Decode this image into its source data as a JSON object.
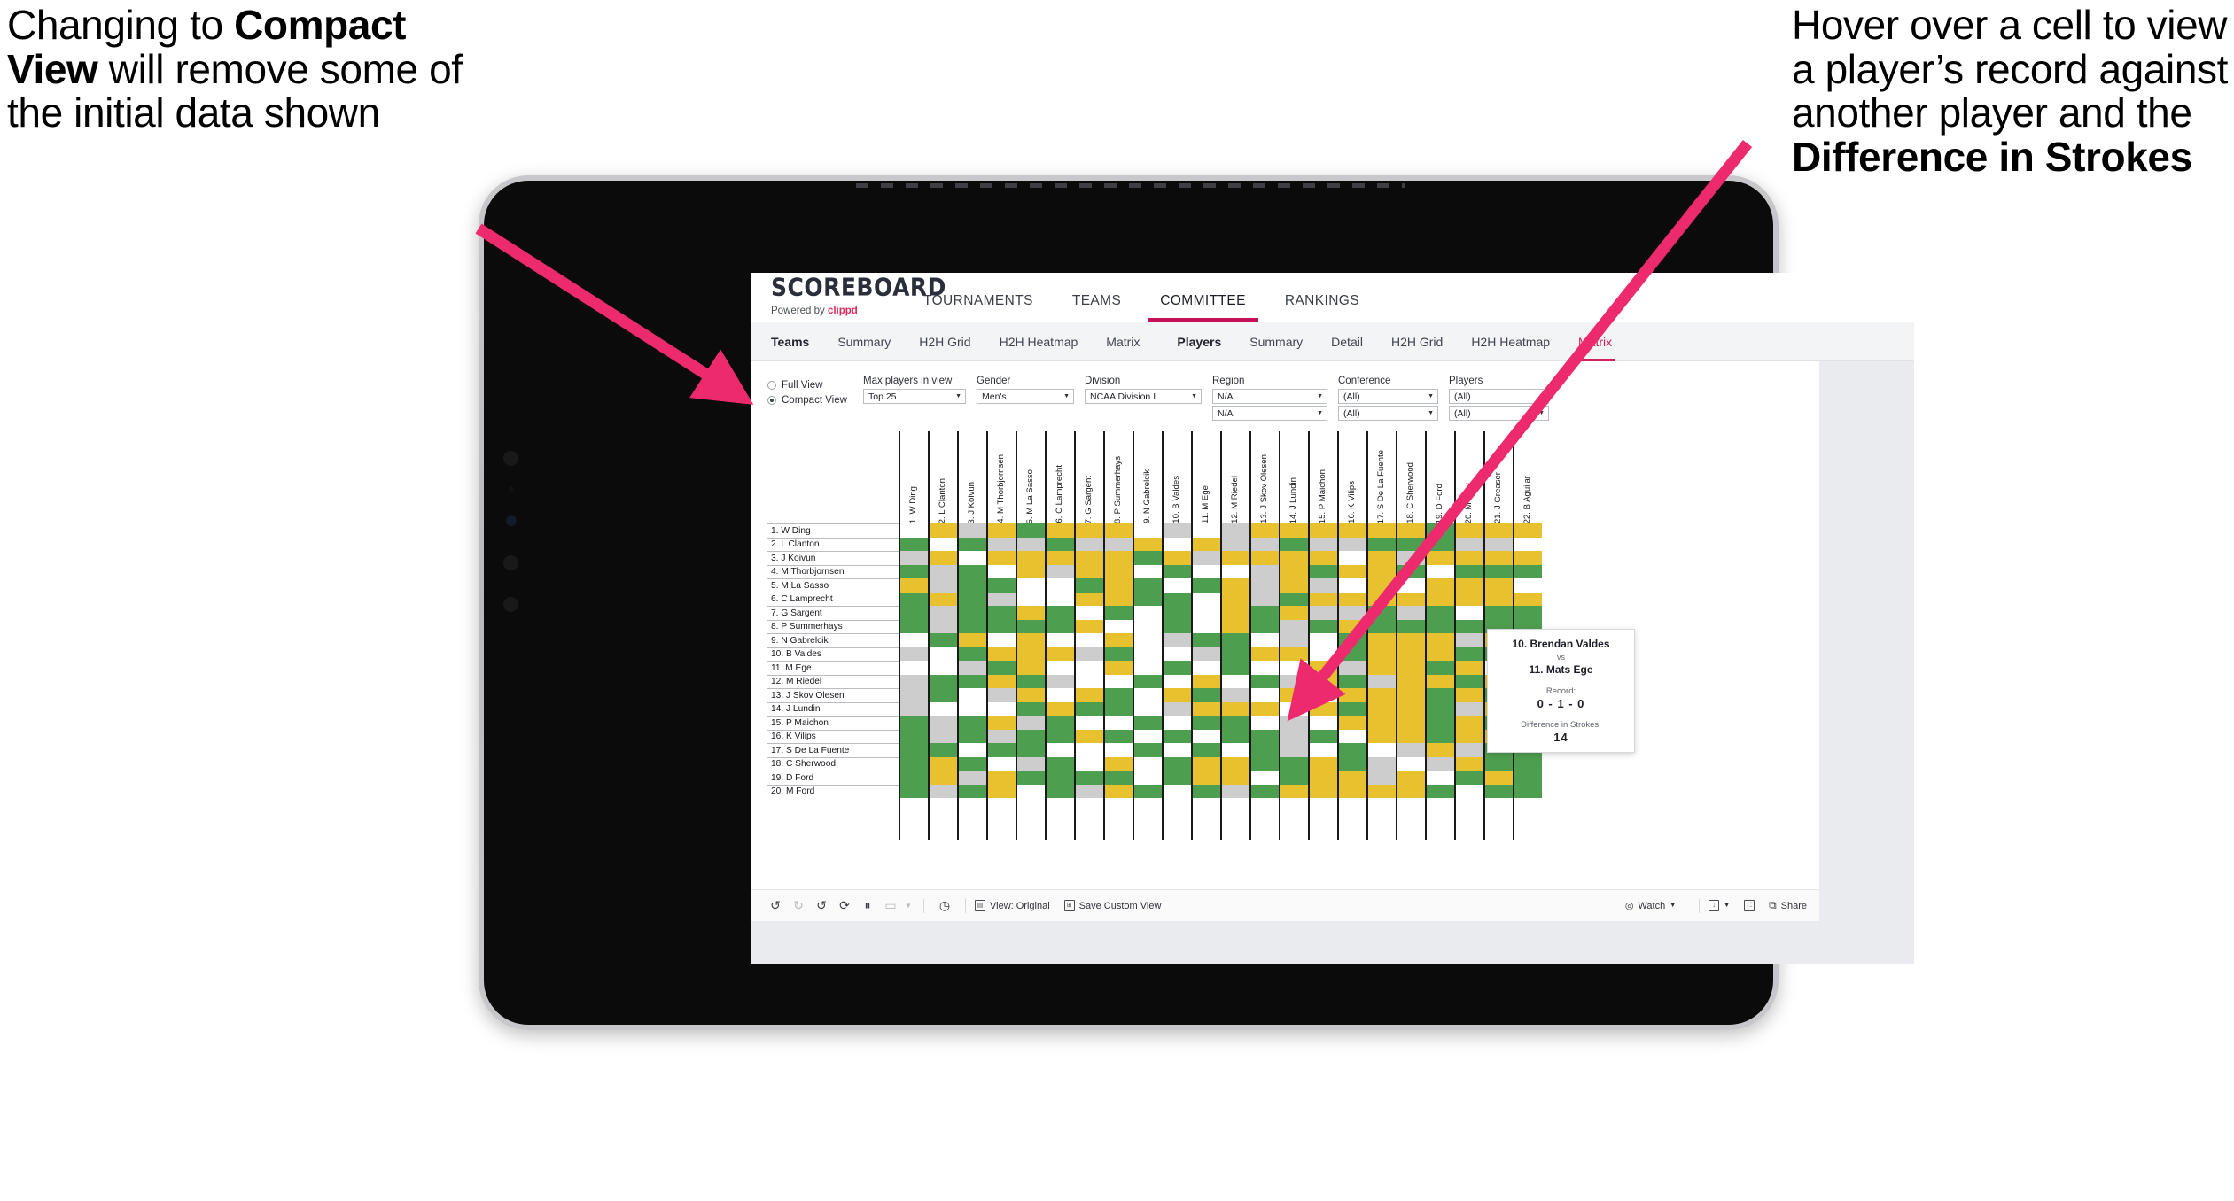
{
  "annotations": {
    "left": {
      "pre": "Changing to ",
      "bold": "Compact View",
      "post": " will remove some of the initial data shown"
    },
    "right": {
      "pre": "Hover over a cell to view a player’s record against another player and the ",
      "bold": "Difference in Strokes",
      "post": ""
    },
    "arrow_color": "#ee2a6e"
  },
  "app": {
    "brand": {
      "title": "SCOREBOARD",
      "powered_prefix": "Powered by ",
      "powered_name": "clippd"
    },
    "main_tabs": [
      {
        "label": "TOURNAMENTS",
        "active": false
      },
      {
        "label": "TEAMS",
        "active": false
      },
      {
        "label": "COMMITTEE",
        "active": true
      },
      {
        "label": "RANKINGS",
        "active": false
      }
    ],
    "sub_tabs_teams_label": "Teams",
    "sub_tabs_teams": [
      {
        "label": "Summary",
        "active": false
      },
      {
        "label": "H2H Grid",
        "active": false
      },
      {
        "label": "H2H Heatmap",
        "active": false
      },
      {
        "label": "Matrix",
        "active": false
      }
    ],
    "sub_tabs_players_label": "Players",
    "sub_tabs_players": [
      {
        "label": "Summary",
        "active": false
      },
      {
        "label": "Detail",
        "active": false
      },
      {
        "label": "H2H Grid",
        "active": false
      },
      {
        "label": "H2H Heatmap",
        "active": false
      },
      {
        "label": "Matrix",
        "active": true
      }
    ],
    "accent": "#c8105a"
  },
  "filters": {
    "view_mode": [
      {
        "label": "Full View",
        "selected": false
      },
      {
        "label": "Compact View",
        "selected": true
      }
    ],
    "fields": [
      {
        "label": "Max players in view",
        "value": "Top 25",
        "second": null
      },
      {
        "label": "Gender",
        "value": "Men's",
        "second": null
      },
      {
        "label": "Division",
        "value": "NCAA Division I",
        "second": null
      },
      {
        "label": "Region",
        "value": "N/A",
        "second": "N/A"
      },
      {
        "label": "Conference",
        "value": "(All)",
        "second": "(All)"
      },
      {
        "label": "Players",
        "value": "(All)",
        "second": "(All)"
      }
    ]
  },
  "matrix": {
    "row_labels": [
      "1. W Ding",
      "2. L Clanton",
      "3. J Koivun",
      "4. M Thorbjornsen",
      "5. M La Sasso",
      "6. C Lamprecht",
      "7. G Sargent",
      "8. P Summerhays",
      "9. N Gabrelcik",
      "10. B Valdes",
      "11. M Ege",
      "12. M Riedel",
      "13. J Skov Olesen",
      "14. J Lundin",
      "15. P Maichon",
      "16. K Vilips",
      "17. S De La Fuente",
      "18. C Sherwood",
      "19. D Ford",
      "20. M Ford"
    ],
    "col_labels": [
      "1. W Ding",
      "2. L Clanton",
      "3. J Koivun",
      "4. M Thorbjornsen",
      "5. M La Sasso",
      "6. C Lamprecht",
      "7. G Sargent",
      "8. P Summerhays",
      "9. N Gabrelcik",
      "10. B Valdes",
      "11. M Ege",
      "12. M Riedel",
      "13. J Skov Olesen",
      "14. J Lundin",
      "15. P Maichon",
      "16. K Vilips",
      "17. S De La Fuente",
      "18. C Sherwood",
      "19. D Ford",
      "20. M Ford",
      "21. J Greaser",
      "22. B Aguilar"
    ],
    "legend_colors": {
      "win": "#4e9e4f",
      "tie": "#e8c22e",
      "loss": "#cdcdcd",
      "none": "#ffffff"
    },
    "cells": [
      [
        "w",
        "y",
        "s",
        "y",
        "g",
        "y",
        "y",
        "y",
        "w",
        "s",
        "w",
        "s",
        "y",
        "y",
        "y",
        "y",
        "y",
        "y",
        "g",
        "y",
        "y",
        "y"
      ],
      [
        "g",
        "w",
        "g",
        "s",
        "s",
        "g",
        "s",
        "s",
        "y",
        "w",
        "y",
        "s",
        "s",
        "g",
        "s",
        "s",
        "g",
        "g",
        "g",
        "s",
        "s",
        "w"
      ],
      [
        "s",
        "y",
        "w",
        "y",
        "y",
        "y",
        "y",
        "y",
        "g",
        "y",
        "s",
        "y",
        "y",
        "y",
        "y",
        "w",
        "y",
        "s",
        "y",
        "y",
        "y",
        "y"
      ],
      [
        "g",
        "s",
        "g",
        "w",
        "y",
        "s",
        "y",
        "y",
        "w",
        "g",
        "w",
        "w",
        "s",
        "y",
        "g",
        "y",
        "y",
        "g",
        "w",
        "g",
        "g",
        "g"
      ],
      [
        "y",
        "s",
        "g",
        "g",
        "w",
        "w",
        "g",
        "y",
        "g",
        "w",
        "g",
        "y",
        "s",
        "y",
        "s",
        "w",
        "y",
        "w",
        "y",
        "y",
        "y",
        "w"
      ],
      [
        "g",
        "y",
        "g",
        "s",
        "w",
        "w",
        "y",
        "y",
        "g",
        "g",
        "w",
        "y",
        "s",
        "g",
        "y",
        "y",
        "y",
        "y",
        "y",
        "y",
        "y",
        "y"
      ],
      [
        "g",
        "s",
        "g",
        "g",
        "y",
        "g",
        "w",
        "g",
        "w",
        "g",
        "w",
        "y",
        "g",
        "y",
        "s",
        "s",
        "g",
        "s",
        "g",
        "w",
        "g",
        "g"
      ],
      [
        "g",
        "s",
        "g",
        "g",
        "g",
        "g",
        "y",
        "w",
        "w",
        "g",
        "w",
        "y",
        "g",
        "s",
        "g",
        "y",
        "g",
        "g",
        "g",
        "g",
        "g",
        "g"
      ],
      [
        "w",
        "g",
        "y",
        "w",
        "y",
        "w",
        "w",
        "y",
        "w",
        "s",
        "g",
        "g",
        "w",
        "s",
        "w",
        "g",
        "y",
        "y",
        "y",
        "s",
        "y",
        "y"
      ],
      [
        "s",
        "w",
        "g",
        "y",
        "y",
        "y",
        "s",
        "g",
        "w",
        "w",
        "s",
        "g",
        "y",
        "y",
        "w",
        "g",
        "y",
        "y",
        "y",
        "g",
        "g",
        "g"
      ],
      [
        "w",
        "w",
        "s",
        "g",
        "y",
        "w",
        "w",
        "y",
        "w",
        "g",
        "w",
        "g",
        "w",
        "w",
        "y",
        "s",
        "y",
        "y",
        "g",
        "y",
        "w",
        "s"
      ],
      [
        "s",
        "g",
        "g",
        "y",
        "g",
        "s",
        "w",
        "w",
        "g",
        "w",
        "y",
        "w",
        "g",
        "s",
        "y",
        "g",
        "s",
        "y",
        "y",
        "g",
        "y",
        "g"
      ],
      [
        "s",
        "g",
        "w",
        "s",
        "y",
        "w",
        "y",
        "g",
        "w",
        "y",
        "g",
        "s",
        "w",
        "y",
        "w",
        "y",
        "y",
        "y",
        "g",
        "y",
        "g",
        "g"
      ],
      [
        "s",
        "w",
        "w",
        "w",
        "g",
        "y",
        "g",
        "g",
        "w",
        "s",
        "y",
        "y",
        "y",
        "w",
        "y",
        "g",
        "y",
        "y",
        "g",
        "s",
        "y",
        "g"
      ],
      [
        "g",
        "s",
        "g",
        "y",
        "s",
        "g",
        "w",
        "w",
        "g",
        "w",
        "g",
        "g",
        "w",
        "s",
        "w",
        "y",
        "y",
        "y",
        "g",
        "y",
        "g",
        "w"
      ],
      [
        "g",
        "s",
        "g",
        "s",
        "g",
        "g",
        "y",
        "g",
        "w",
        "g",
        "w",
        "g",
        "g",
        "s",
        "g",
        "w",
        "y",
        "y",
        "g",
        "y",
        "y",
        "w"
      ],
      [
        "g",
        "g",
        "w",
        "g",
        "g",
        "w",
        "w",
        "w",
        "g",
        "w",
        "g",
        "w",
        "g",
        "s",
        "w",
        "g",
        "w",
        "s",
        "y",
        "s",
        "g",
        "g"
      ],
      [
        "g",
        "y",
        "g",
        "w",
        "s",
        "g",
        "w",
        "y",
        "w",
        "g",
        "y",
        "y",
        "g",
        "g",
        "y",
        "g",
        "s",
        "w",
        "s",
        "y",
        "g",
        "g"
      ],
      [
        "g",
        "y",
        "s",
        "y",
        "g",
        "g",
        "g",
        "g",
        "w",
        "g",
        "y",
        "y",
        "w",
        "g",
        "y",
        "y",
        "s",
        "y",
        "w",
        "g",
        "y",
        "g"
      ],
      [
        "g",
        "s",
        "g",
        "y",
        "w",
        "g",
        "s",
        "y",
        "g",
        "w",
        "g",
        "s",
        "g",
        "y",
        "y",
        "y",
        "y",
        "y",
        "g",
        "w",
        "g",
        "g"
      ]
    ]
  },
  "tooltip": {
    "player_a": "10. Brendan Valdes",
    "vs": "vs",
    "player_b": "11. Mats Ege",
    "record_label": "Record:",
    "record_value": "0 - 1 - 0",
    "diff_label": "Difference in Strokes:",
    "diff_value": "14"
  },
  "toolbar": {
    "icons": [
      "undo-icon",
      "redo-icon",
      "revert-icon",
      "refresh-icon",
      "pause-icon",
      "rectangle-select-icon",
      "dropdown-caret-icon",
      "presentation-icon"
    ],
    "view_label": "View: Original",
    "save_label": "Save Custom View",
    "watch_label": "Watch",
    "share_label": "Share"
  }
}
